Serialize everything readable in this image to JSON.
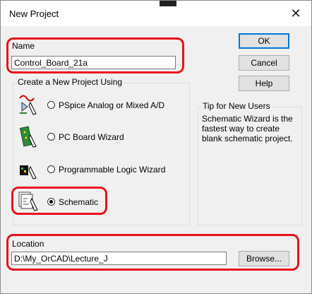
{
  "window": {
    "title": "New Project",
    "close_glyph": "✕"
  },
  "name": {
    "label": "Name",
    "value": "Control_Board_21a"
  },
  "create": {
    "title": "Create a New Project Using",
    "options": [
      {
        "label": "PSpice Analog or Mixed A/D",
        "selected": false,
        "icon": "pspice-analog-icon"
      },
      {
        "label": "PC Board Wizard",
        "selected": false,
        "icon": "pc-board-icon"
      },
      {
        "label": "Programmable Logic Wizard",
        "selected": false,
        "icon": "programmable-logic-icon"
      },
      {
        "label": "Schematic",
        "selected": true,
        "icon": "schematic-icon"
      }
    ]
  },
  "tip": {
    "title": "Tip for New Users",
    "text": "Schematic Wizard is the fastest way to create blank schematic project."
  },
  "location": {
    "label": "Location",
    "value": "D:\\My_OrCAD\\Lecture_J",
    "browse_label": "Browse..."
  },
  "buttons": {
    "ok": "OK",
    "cancel": "Cancel",
    "help": "Help"
  },
  "colors": {
    "highlight": "#e8121d",
    "accent": "#0078d7"
  }
}
